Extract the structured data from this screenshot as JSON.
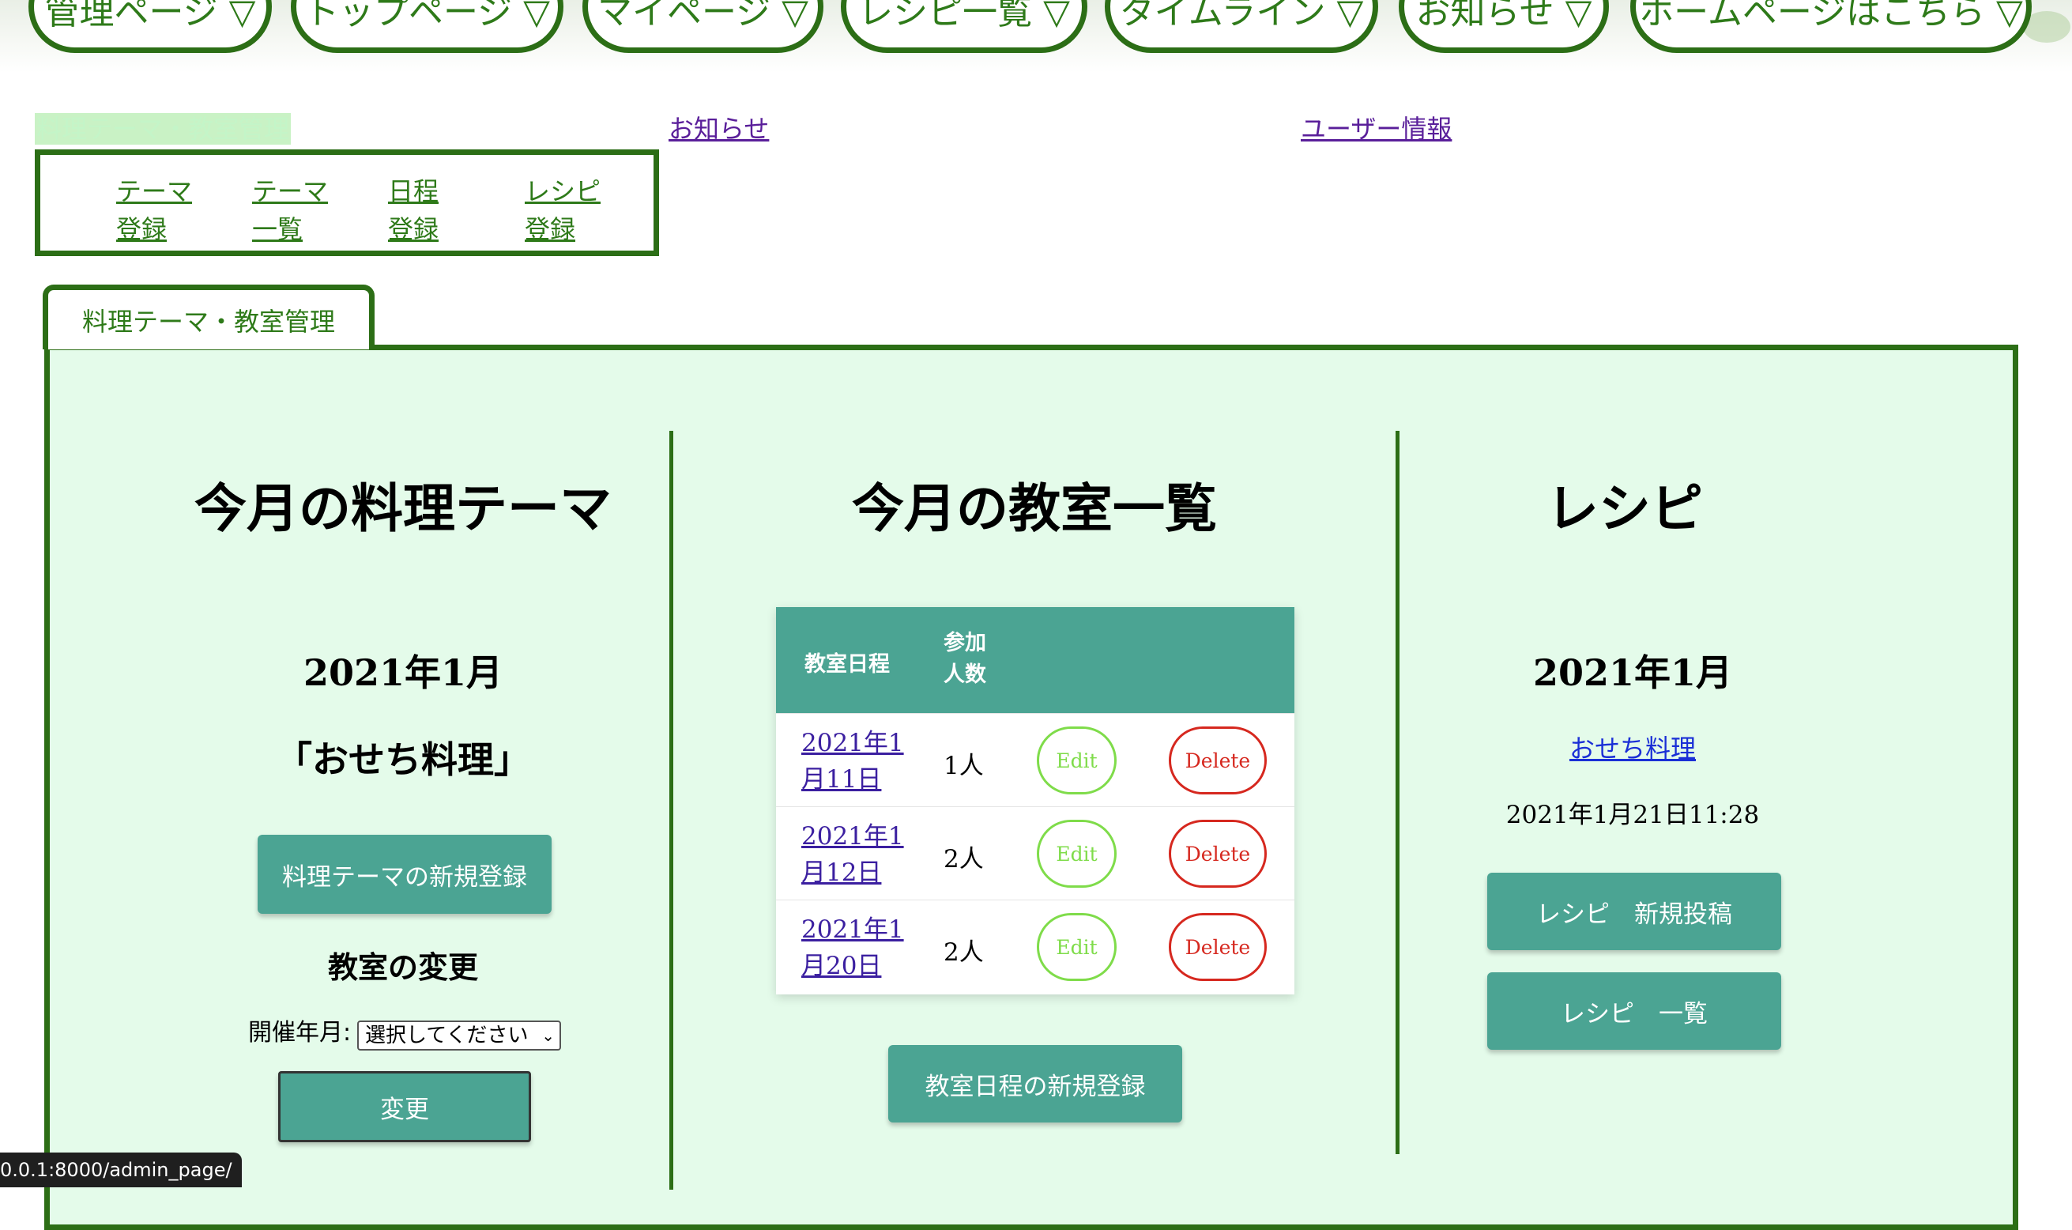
{
  "nav": {
    "items": [
      {
        "label": "管理ページ ▽"
      },
      {
        "label": "トップページ ▽"
      },
      {
        "label": "マイページ ▽"
      },
      {
        "label": "レシピ一覧 ▽"
      },
      {
        "label": "タイムライン ▽"
      },
      {
        "label": "お知らせ ▽"
      },
      {
        "label": "ホームページはこちら ▽"
      }
    ]
  },
  "header": {
    "breadcrumb": "料理テーマ・教室管理",
    "news_link": "お知らせ",
    "user_link": "ユーザー情報",
    "submenu": [
      {
        "line1": "テーマ",
        "line2": "登録"
      },
      {
        "line1": "テーマ",
        "line2": "一覧"
      },
      {
        "line1": "日程",
        "line2": "登録"
      },
      {
        "line1": "レシピ",
        "line2": "登録"
      }
    ]
  },
  "tab": {
    "label": "料理テーマ・教室管理"
  },
  "theme": {
    "title": "今月の料理テーマ",
    "month": "2021年1月",
    "name": "「おせち料理」",
    "new_button": "料理テーマの新規登録",
    "change_heading": "教室の変更",
    "period_label": "開催年月:",
    "select_value": "選択してください",
    "change_button": "変更"
  },
  "classes": {
    "title": "今月の教室一覧",
    "header_date": "教室日程",
    "header_count_1": "参加",
    "header_count_2": "人数",
    "rows": [
      {
        "date1": "2021年1",
        "date2": "月11日",
        "count": "1人",
        "edit": "Edit",
        "delete": "Delete"
      },
      {
        "date1": "2021年1",
        "date2": "月12日",
        "count": "2人",
        "edit": "Edit",
        "delete": "Delete"
      },
      {
        "date1": "2021年1",
        "date2": "月20日",
        "count": "2人",
        "edit": "Edit",
        "delete": "Delete"
      }
    ],
    "new_button": "教室日程の新規登録"
  },
  "recipe": {
    "title": "レシピ",
    "month": "2021年1月",
    "link": "おせち料理",
    "datetime": "2021年1月21日11:28",
    "post_button": "レシピ　新規投稿",
    "list_button": "レシピ　一覧"
  },
  "statusbar": {
    "url": "0.0.1:8000/admin_page/"
  },
  "colors": {
    "frame": "#2c6e16",
    "accent": "#4ba493",
    "panel": "#e4fbea",
    "edit": "#7fdc4a",
    "delete": "#d6281f"
  }
}
